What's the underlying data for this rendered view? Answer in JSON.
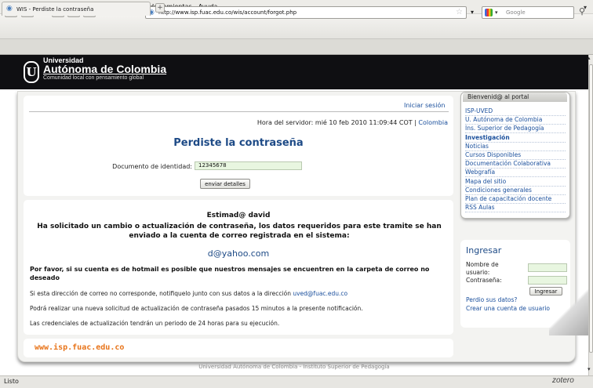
{
  "menu": [
    "Archivo",
    "Editar",
    "Ver",
    "Historial",
    "Marcadores",
    "Herramientas",
    "Ayuda"
  ],
  "menu_access_keys": [
    "A",
    "E",
    "V",
    "H",
    "M",
    "t",
    "y"
  ],
  "toolbar": {
    "back": "◄",
    "forward": "►",
    "dropdown": "▾",
    "reload": "↻",
    "stop": "✕",
    "home": "⌂",
    "bookmark": "❦",
    "url": "http://www.isp.fuac.edu.co/wis/account/forgot.php",
    "search_placeholder": "Google"
  },
  "tab": {
    "title": "WIS - Perdiste la contraseña"
  },
  "site": {
    "brand_line1": "Universidad",
    "brand_line2": "Autónoma de Colombia",
    "brand_line3": "Comunidad local con pensamiento global",
    "logo_letter": "U"
  },
  "main": {
    "login_link": "Iniciar sesión",
    "server_time": "Hora del servidor: mié 10 feb 2010 11:09:44 COT | ",
    "server_time_link": "Colombia",
    "title": "Perdiste la contraseña",
    "doc_label": "Documento de identidad:",
    "doc_value": "12345678",
    "send_button": "enviar detalles"
  },
  "result": {
    "greeting": "Estimad@ david",
    "message": "Ha solicitado un cambio o actualización de contraseña, los datos requeridos para este tramite se han enviado a la cuenta de correo registrada en el sistema:",
    "email": "d@yahoo.com",
    "hotmail_notice": "Por favor, si su cuenta es de hotmail es posible que nuestros mensajes se encuentren en la carpeta de correo no deseado",
    "p1_text": "Si esta dirección de correo no corresponde, notifiquelo junto con sus datos a la dirección ",
    "p1_link": "uved@fuac.edu.co",
    "p2": "Podrá realizar una nueva solicitud de actualización de contraseña pasados 15 minutos a la presente notificación.",
    "p3": "Las credenciales de actualización tendrán un periodo de 24 horas para su ejecución.",
    "site_url": "www.isp.fuac.edu.co"
  },
  "sidebar": {
    "header": "Bienvenid@ al portal",
    "items": [
      {
        "label": "ISP-UVED",
        "bold": false
      },
      {
        "label": "U. Autónoma de Colombia",
        "bold": false
      },
      {
        "label": "Ins. Superior de Pedagogía",
        "bold": false
      },
      {
        "label": "Investigación",
        "bold": true
      },
      {
        "label": "Noticias",
        "bold": false
      },
      {
        "label": "Cursos Disponibles",
        "bold": false
      },
      {
        "label": "Documentación Colaborativa",
        "bold": false
      },
      {
        "label": "Webgrafía",
        "bold": false
      },
      {
        "label": "Mapa del sitio",
        "bold": false
      },
      {
        "label": "Condiciones generales",
        "bold": false
      },
      {
        "label": "Plan de capacitación docente",
        "bold": false
      },
      {
        "label": "RSS Aulas",
        "bold": false
      }
    ]
  },
  "login": {
    "title": "Ingresar",
    "user_label": "Nombre de usuario:",
    "pass_label": "Contraseña:",
    "button": "Ingresar",
    "forgot": "Perdio sus datos?",
    "create": "Crear una cuenta de usuario"
  },
  "footer": "Universidad Autónoma de Colombia - Instituto Superior de Pedagogía",
  "status": "Listo",
  "zotero": "zotero"
}
